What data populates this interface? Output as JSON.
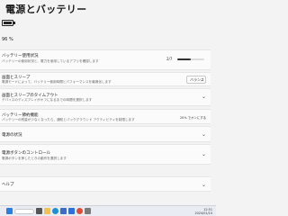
{
  "page": {
    "title": "電源とバッテリー"
  },
  "battery": {
    "percent": "96 %",
    "level": 0.9
  },
  "usage": {
    "title": "バッテリー使用状況",
    "subtitle": "バッテリーの使用状況と、電力を使用しているアプリを確認します",
    "value": "2/7",
    "progress": 0.5
  },
  "cell": {
    "title": "画面とスリープ",
    "subtitle": "電源モードによって、バッテリー使用時間とパフォーマンスを最適化します",
    "value": "バランス"
  },
  "timeout": {
    "title": "画面とスリープのタイムアウト",
    "subtitle": "デバイスのディスプレイがオフになるまでの時間を選択します"
  },
  "saver": {
    "title": "バッテリー節約機能",
    "subtitle": "バッテリーの残量が少なくなったら、通知とバックグラウンド アクティビティを制限します",
    "value": "20% でオンにする"
  },
  "status": {
    "title": "電源の状況"
  },
  "control": {
    "title": "電源ボタンのコントロール",
    "subtitle": "電源ボタンを押したときの動作を選択します"
  },
  "help": {
    "title": "ヘルプ"
  },
  "taskbar": {
    "time": "12:51",
    "date": "2024/01/10"
  },
  "colors": {
    "start": "#2a7de1",
    "accent": "#333333"
  }
}
